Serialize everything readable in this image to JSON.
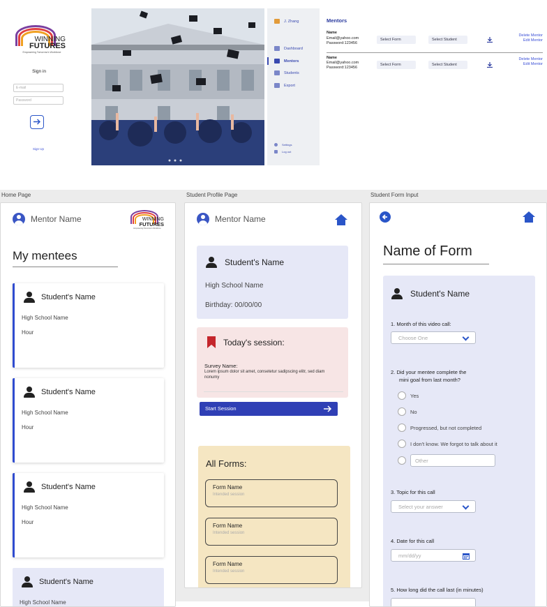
{
  "login": {
    "logo_line1": "WINNING",
    "logo_line2": "FUTURES",
    "logo_tagline": "Empowering Tomorrow's Workforce",
    "title": "Sign in",
    "email_placeholder": "E-mail",
    "password_placeholder": "Password",
    "signup": "Sign Up"
  },
  "admin": {
    "user": "J. Zhang",
    "nav": [
      "Dashboard",
      "Mentors",
      "Students",
      "Export"
    ],
    "footer": [
      "Settings",
      "Log out"
    ],
    "title": "Mentors",
    "rows": [
      {
        "name": "Name",
        "email": "Email@yahoo.com",
        "password": "Password:123456",
        "form": "Select Form",
        "student": "Select Student",
        "delete": "Delete Mentor",
        "edit": "Edit Mentor"
      },
      {
        "name": "Name",
        "email": "Email@yahoo.com",
        "password": "Password:123456",
        "form": "Select Form",
        "student": "Select Student",
        "delete": "Delete Mentor",
        "edit": "Edit Mentor"
      }
    ]
  },
  "labels": {
    "home": "Home Page",
    "profile": "Student Profile Page",
    "form": "Student Form Input"
  },
  "home": {
    "mentor": "Mentor Name",
    "title": "My mentees",
    "cards": [
      {
        "name": "Student's Name",
        "school": "High School Name",
        "hour": "Hour"
      },
      {
        "name": "Student's Name",
        "school": "High School Name",
        "hour": "Hour"
      },
      {
        "name": "Student's Name",
        "school": "High School Name",
        "hour": "Hour"
      },
      {
        "name": "Student's Name",
        "school": "High School Name",
        "hour": ""
      }
    ]
  },
  "profile": {
    "mentor": "Mentor Name",
    "student": "Student's Name",
    "school": "High School Name",
    "birthday": "Birthday: 00/00/00",
    "session_title": "Today's session:",
    "survey_label": "Survey Name:",
    "survey_text": "Lorem ipsum dolor sit amet, consetetur sadipscing elitr, sed diam nonumy",
    "start": "Start Session",
    "all_forms": "All Forms:",
    "forms": [
      {
        "name": "Form Name",
        "sub": "Intended session"
      },
      {
        "name": "Form Name",
        "sub": "Intended session"
      },
      {
        "name": "Form Name",
        "sub": "Intended session"
      }
    ]
  },
  "form": {
    "title": "Name of Form",
    "student": "Student's Name",
    "q1": "1. Month of this video call:",
    "q1_value": "Choose One",
    "q2": "2. Did your mentee complete the",
    "q2b": "mini goal from last month?",
    "options": [
      "Yes",
      "No",
      "Progressed, but not completed",
      "I don't know. We forgot to talk about it"
    ],
    "other": "Other",
    "q3": "3. Topic for this call",
    "q3_value": "Select your answer",
    "q4": "4. Date for this call",
    "q4_value": "mm/dd/yy",
    "q5": "5. How long did the call last (in minutes)"
  },
  "colors": {
    "accent": "#2a55c8",
    "card_blue": "#e6e8f7",
    "card_pink": "#f7e5e5",
    "card_yellow": "#f5e6c2"
  }
}
